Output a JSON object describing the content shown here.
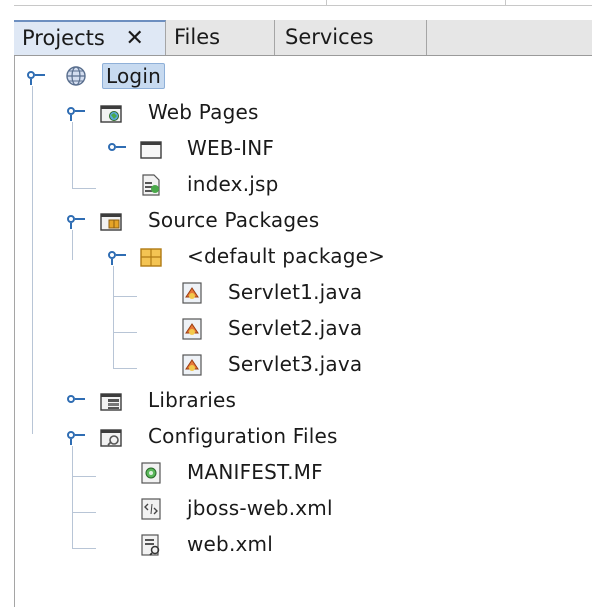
{
  "tabs": [
    {
      "label": "Projects",
      "close": "✕",
      "active": true
    },
    {
      "label": "Files",
      "active": false
    },
    {
      "label": "Services",
      "active": false
    }
  ],
  "tree": {
    "root": {
      "label": "Login",
      "icon": "globe-icon"
    },
    "web_pages": {
      "label": "Web Pages",
      "icon": "web-folder-icon",
      "children": [
        {
          "label": "WEB-INF",
          "icon": "folder-icon"
        },
        {
          "label": "index.jsp",
          "icon": "jsp-file-icon"
        }
      ]
    },
    "source_packages": {
      "label": "Source Packages",
      "icon": "source-folder-icon",
      "package": {
        "label": "<default package>",
        "icon": "package-icon"
      },
      "files": [
        {
          "label": "Servlet1.java",
          "icon": "java-file-icon"
        },
        {
          "label": "Servlet2.java",
          "icon": "java-file-icon"
        },
        {
          "label": "Servlet3.java",
          "icon": "java-file-icon"
        }
      ]
    },
    "libraries": {
      "label": "Libraries",
      "icon": "library-folder-icon"
    },
    "config_files": {
      "label": "Configuration Files",
      "icon": "config-folder-icon",
      "children": [
        {
          "label": "MANIFEST.MF",
          "icon": "manifest-file-icon"
        },
        {
          "label": "jboss-web.xml",
          "icon": "xml-file-icon"
        },
        {
          "label": "web.xml",
          "icon": "webxml-file-icon"
        }
      ]
    }
  },
  "colors": {
    "accent": "#2f6db3",
    "selection": "#c7daf0",
    "tree_lines": "#b8c5d6"
  }
}
